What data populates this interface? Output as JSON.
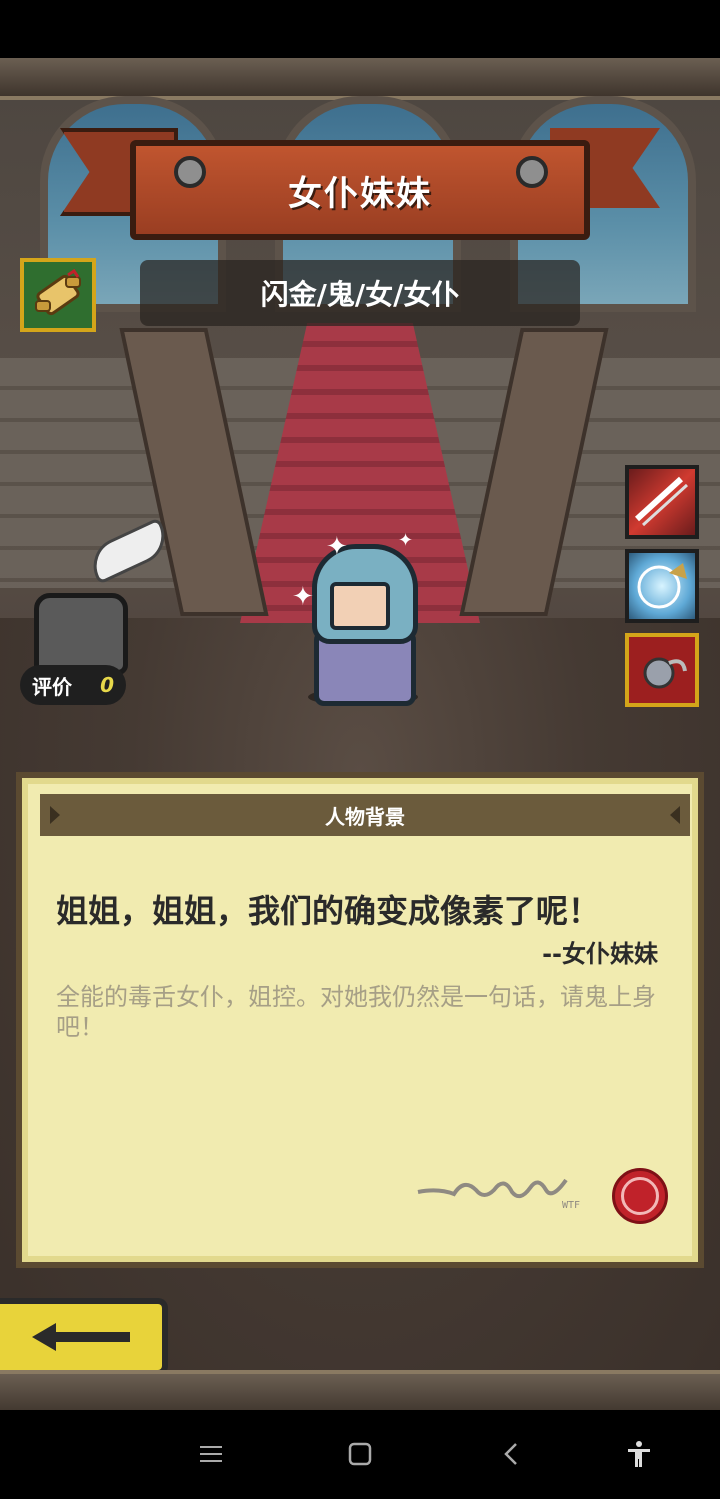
{
  "character": {
    "name": "女仆妹妹",
    "tags": "闪金/鬼/女/女仆"
  },
  "rating": {
    "label": "评价",
    "value": "0"
  },
  "background_panel": {
    "title": "人物背景",
    "quote": "姐姐，姐姐，我们的确变成像素了呢！",
    "quote_author": "--女仆妹妹",
    "description": "全能的毒舌女仆，姐控。对她我仍然是一句话，请鬼上身吧！",
    "signature_mark": "WTF"
  },
  "skills": [
    {
      "icon": "slash-skill-icon"
    },
    {
      "icon": "ice-shield-skill-icon"
    },
    {
      "icon": "chain-mace-skill-icon"
    }
  ],
  "colors": {
    "ribbon": "#b04a28",
    "parchment": "#f1ebb0",
    "back_button": "#e8d33a",
    "rating_value": "#e7d84a"
  }
}
